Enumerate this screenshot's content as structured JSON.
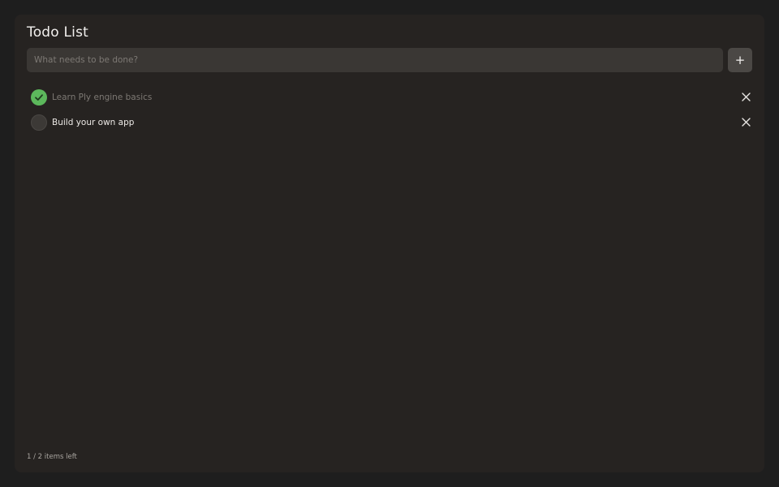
{
  "app": {
    "title": "Todo List"
  },
  "input": {
    "placeholder": "What needs to be done?",
    "value": ""
  },
  "add_button": {
    "label": "+"
  },
  "todos": [
    {
      "label": "Learn Ply engine basics",
      "completed": true
    },
    {
      "label": "Build your own app",
      "completed": false
    }
  ],
  "footer": {
    "status": "1 / 2 items left"
  },
  "icons": {
    "check": "check-icon",
    "delete": "close-icon",
    "add": "plus-icon"
  },
  "colors": {
    "background": "#1e1e1e",
    "panel": "#262321",
    "input": "#3a3734",
    "button": "#4b4845",
    "completed_check": "#5cb85c",
    "text": "#ece9e6",
    "muted_text": "#7d7974"
  }
}
